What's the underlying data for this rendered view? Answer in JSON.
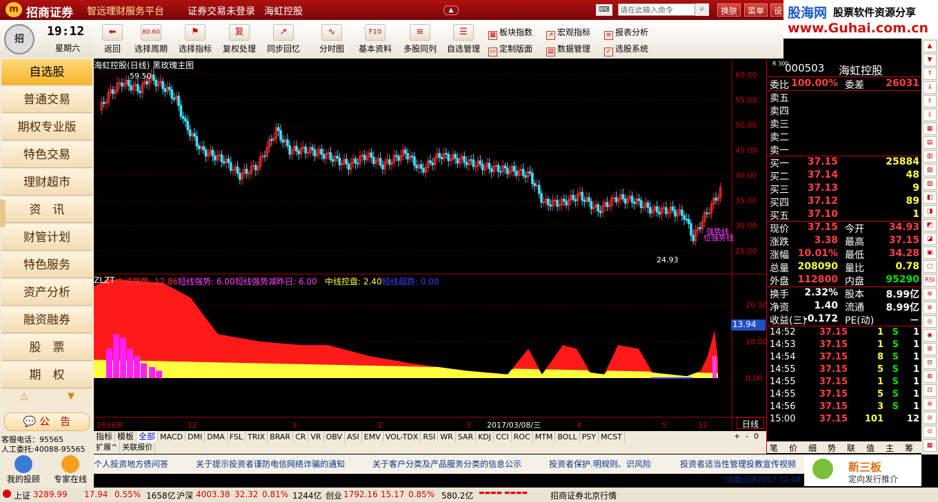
{
  "titlebar": {
    "brand": "招商证券",
    "subtitle": "智远理财服务平台",
    "status": "证券交易未登录",
    "stock": "海虹控股",
    "buttons": [
      "换肤",
      "菜单",
      "设"
    ],
    "cmd_placeholder": "请在此输入命令"
  },
  "watermark": {
    "site": "股海网",
    "slogan": "股票软件资源分享",
    "url": "www.Guhai.com.cn"
  },
  "toolbar": {
    "tools": [
      {
        "label": "返回",
        "icon": "back-arrow-icon",
        "glyph": "⬅"
      },
      {
        "label": "选择周期",
        "icon": "period-icon",
        "glyph": "80.60"
      },
      {
        "label": "选择指标",
        "icon": "indicator-icon",
        "glyph": "⚑"
      },
      {
        "label": "复权处理",
        "icon": "rights-icon",
        "glyph": "复"
      },
      {
        "label": "同步回忆",
        "icon": "sync-icon",
        "glyph": "↗"
      },
      {
        "label": "分时图",
        "icon": "timeshare-icon",
        "glyph": "∿"
      },
      {
        "label": "基本资料",
        "icon": "f10-icon",
        "glyph": "F10"
      },
      {
        "label": "多股同列",
        "icon": "multi-stock-icon",
        "glyph": "≋"
      },
      {
        "label": "自选管理",
        "icon": "watchlist-icon",
        "glyph": "☰"
      }
    ],
    "tools2": [
      {
        "label": "板块指数",
        "icon": "sector-icon"
      },
      {
        "label": "宏观指标",
        "icon": "macro-icon"
      },
      {
        "label": "报表分析",
        "icon": "report-icon"
      },
      {
        "label": "定制版面",
        "icon": "layout-icon"
      },
      {
        "label": "数据管理",
        "icon": "data-icon"
      },
      {
        "label": "选股系统",
        "icon": "screener-icon"
      }
    ]
  },
  "clock": {
    "time": "19:12",
    "weekday": "星期六"
  },
  "nav": [
    "自选股",
    "普通交易",
    "期权专业版",
    "特色交易",
    "理财超市",
    "资　讯",
    "财管计划",
    "特色服务",
    "资产分析",
    "融资融券",
    "股　票",
    "期　权"
  ],
  "notice": "公　告",
  "contact": {
    "phone": "客服电话：95565",
    "agent": "人工委托:40088-95565"
  },
  "bottom_icons": [
    "我的投顾",
    "专家在线"
  ],
  "chart": {
    "title": "海虹控股(日线) 黑玫瑰主图",
    "high_label": "59.50",
    "low_label": "24.93",
    "price_ticks": [
      "60.00",
      "55.00",
      "50.00",
      "45.00",
      "40.00",
      "35.00",
      "30.00",
      "25.00"
    ],
    "annot": [
      "强势线",
      "位强势线"
    ],
    "sub_title": "ZLZT",
    "sub_items": [
      {
        "text": "中线强势: 12.86",
        "color": "#ff3030"
      },
      {
        "text": "短线强势: 6.00",
        "color": "#ff40ff"
      },
      {
        "text": "短线强势减昨日: 6.00",
        "color": "#ff40ff"
      },
      {
        "text": "中线控盘: 2.40",
        "color": "#ffff40"
      },
      {
        "text": "短线超跌: 0.00",
        "color": "#4040ff"
      }
    ],
    "sub_ticks": [
      "20.00",
      "10.00",
      "0.00"
    ],
    "sub_current": "13.94",
    "dates": [
      "2016年",
      "12",
      "1",
      "2",
      "3",
      "2017/03/08/三",
      "4",
      "5",
      "12"
    ],
    "period": "日线"
  },
  "chart_data": {
    "type": "candlestick",
    "series": [
      {
        "name": "海虹控股(日线)",
        "high": 59.5,
        "low": 24.93,
        "last": 37.15
      }
    ],
    "ylim": [
      22,
      62
    ]
  },
  "index_tabs": [
    "指标",
    "模板",
    "全部",
    "MACD",
    "DMI",
    "DMA",
    "FSL",
    "TRIX",
    "BRAR",
    "CR",
    "VR",
    "OBV",
    "ASI",
    "EMV",
    "VOL-TDX",
    "RSI",
    "WR",
    "SAR",
    "KDJ",
    "CCI",
    "ROC",
    "MTM",
    "BOLL",
    "PSY",
    "MCST"
  ],
  "expand_tabs": [
    "扩展^",
    "关联报价"
  ],
  "quote": {
    "code": "000503",
    "name": "海虹控股",
    "market": "R 300",
    "wb": {
      "label": "委比",
      "value": "100.00%",
      "diff_label": "委差",
      "diff": "26031"
    },
    "asks": [
      "卖五",
      "卖四",
      "卖三",
      "卖二",
      "卖一"
    ],
    "bids": [
      {
        "l": "买一",
        "p": "37.15",
        "v": "25884"
      },
      {
        "l": "买二",
        "p": "37.14",
        "v": "48"
      },
      {
        "l": "买三",
        "p": "37.13",
        "v": "9"
      },
      {
        "l": "买四",
        "p": "37.12",
        "v": "89"
      },
      {
        "l": "买五",
        "p": "37.10",
        "v": "1"
      }
    ],
    "stats": [
      {
        "l": "现价",
        "v": "37.15",
        "c": "red",
        "l2": "今开",
        "v2": "34.93",
        "c2": "red"
      },
      {
        "l": "涨跌",
        "v": "3.38",
        "c": "red",
        "l2": "最高",
        "v2": "37.15",
        "c2": "red"
      },
      {
        "l": "涨幅",
        "v": "10.01%",
        "c": "red",
        "l2": "最低",
        "v2": "34.28",
        "c2": "red"
      },
      {
        "l": "总量",
        "v": "208090",
        "c": "yellow",
        "l2": "量比",
        "v2": "0.78",
        "c2": "yellow"
      },
      {
        "l": "外盘",
        "v": "112800",
        "c": "red",
        "l2": "内盘",
        "v2": "95290",
        "c2": "green"
      }
    ],
    "stats2": [
      {
        "l": "换手",
        "v": "2.32%",
        "l2": "股本",
        "v2": "8.99亿"
      },
      {
        "l": "净资",
        "v": "1.40",
        "l2": "流通",
        "v2": "8.99亿"
      },
      {
        "l": "收益(三)",
        "v": "-0.172",
        "l2": "PE(动)",
        "v2": "－"
      }
    ],
    "ticks": [
      {
        "t": "14:52",
        "p": "37.15",
        "v": "1",
        "s": "S",
        "n": "1"
      },
      {
        "t": "14:53",
        "p": "37.15",
        "v": "1",
        "s": "S",
        "n": "1"
      },
      {
        "t": "14:54",
        "p": "37.15",
        "v": "8",
        "s": "S",
        "n": "1"
      },
      {
        "t": "14:55",
        "p": "37.15",
        "v": "5",
        "s": "S",
        "n": "1"
      },
      {
        "t": "14:55",
        "p": "37.15",
        "v": "1",
        "s": "S",
        "n": "1"
      },
      {
        "t": "14:55",
        "p": "37.15",
        "v": "5",
        "s": "S",
        "n": "1"
      },
      {
        "t": "14:56",
        "p": "37.15",
        "v": "3",
        "s": "S",
        "n": "1"
      },
      {
        "t": "15:00",
        "p": "37.15",
        "v": "101",
        "s": "",
        "n": "12"
      }
    ],
    "bottom_tabs": [
      "笔",
      "价",
      "细",
      "势",
      "联",
      "值",
      "主",
      "筹"
    ]
  },
  "ticker": [
    "个人投资地方债问答",
    "关于提示投资者谨防电信网络诈骗的通知",
    "关于客户分类及产品服务分类的信息公示",
    "投资者保护.明规则、识风险",
    "投资者适当性管理投教宣传视频"
  ],
  "ticker_sub": "*收盘点评2017-12-08",
  "ad": {
    "title": "新三板",
    "sub": "定向发行推介"
  },
  "status": {
    "sh_label": "上证",
    "sh": "3289.99",
    "sh_chg": "17.94",
    "sh_pct": "0.55%",
    "sh_amt": "1658亿",
    "sz_label": "沪深",
    "sz": "4003.38",
    "sz_chg": "32.32",
    "sz_pct": "0.81%",
    "sz_amt": "1244亿",
    "cy_label": "创业",
    "cy": "1792.16",
    "cy_chg": "15.17",
    "cy_pct": "0.85%",
    "cy_amt": "580.2亿",
    "broker": "招商证券北京行情"
  }
}
